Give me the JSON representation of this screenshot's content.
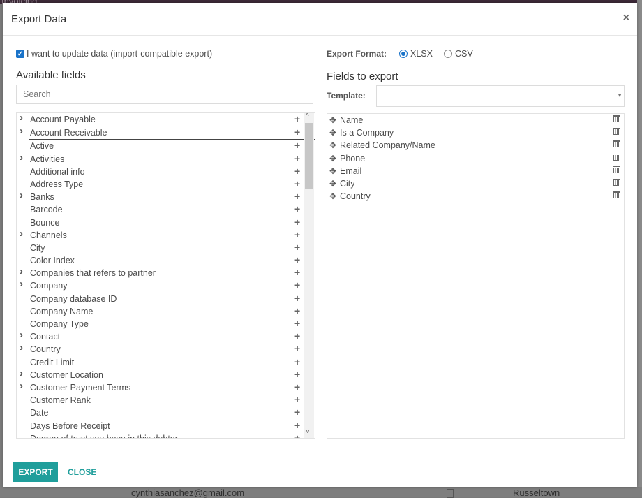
{
  "background": {
    "top_text": "Invoicing",
    "email": "cynthiasanchez@gmail.com",
    "city": "Russeltown"
  },
  "modal": {
    "title": "Export Data",
    "close_icon": "×"
  },
  "import_compatible": {
    "checked": true,
    "label": "I want to update data (import-compatible export)"
  },
  "available": {
    "title": "Available fields",
    "search_placeholder": "Search",
    "fields": [
      {
        "label": "Account Payable",
        "expandable": true
      },
      {
        "label": "Account Receivable",
        "expandable": true
      },
      {
        "label": "Active",
        "expandable": false
      },
      {
        "label": "Activities",
        "expandable": true
      },
      {
        "label": "Additional info",
        "expandable": false
      },
      {
        "label": "Address Type",
        "expandable": false
      },
      {
        "label": "Banks",
        "expandable": true
      },
      {
        "label": "Barcode",
        "expandable": false
      },
      {
        "label": "Bounce",
        "expandable": false
      },
      {
        "label": "Channels",
        "expandable": true
      },
      {
        "label": "City",
        "expandable": false
      },
      {
        "label": "Color Index",
        "expandable": false
      },
      {
        "label": "Companies that refers to partner",
        "expandable": true
      },
      {
        "label": "Company",
        "expandable": true
      },
      {
        "label": "Company database ID",
        "expandable": false
      },
      {
        "label": "Company Name",
        "expandable": false
      },
      {
        "label": "Company Type",
        "expandable": false
      },
      {
        "label": "Contact",
        "expandable": true
      },
      {
        "label": "Country",
        "expandable": true
      },
      {
        "label": "Credit Limit",
        "expandable": false
      },
      {
        "label": "Customer Location",
        "expandable": true
      },
      {
        "label": "Customer Payment Terms",
        "expandable": true
      },
      {
        "label": "Customer Rank",
        "expandable": false
      },
      {
        "label": "Date",
        "expandable": false
      },
      {
        "label": "Days Before Receipt",
        "expandable": false
      },
      {
        "label": "Degree of trust you have in this debtor",
        "expandable": false
      }
    ],
    "highlighted_index": 1
  },
  "format": {
    "label": "Export Format:",
    "options": [
      {
        "label": "XLSX",
        "selected": true
      },
      {
        "label": "CSV",
        "selected": false
      }
    ]
  },
  "to_export": {
    "title": "Fields to export",
    "template_label": "Template:",
    "template_value": "",
    "fields": [
      "Name",
      "Is a Company",
      "Related Company/Name",
      "Phone",
      "Email",
      "City",
      "Country"
    ]
  },
  "footer": {
    "export_label": "EXPORT",
    "close_label": "CLOSE"
  },
  "colors": {
    "accent": "#1f9e9b",
    "checkbox": "#1a73c9"
  }
}
